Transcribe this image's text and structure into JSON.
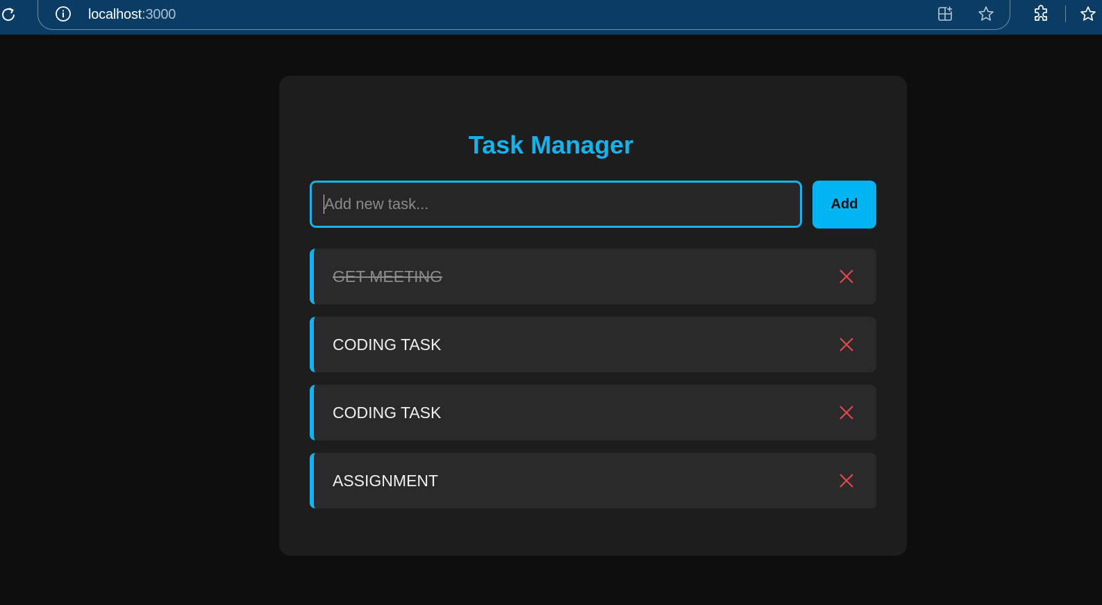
{
  "browser": {
    "url_host": "localhost",
    "url_port": ":3000",
    "icons": [
      "reload-icon",
      "info-icon",
      "app-available-icon",
      "favorite-star-icon",
      "extensions-icon",
      "favorites-icon"
    ]
  },
  "app": {
    "title": "Task Manager",
    "input": {
      "placeholder": "Add new task...",
      "value": ""
    },
    "add_label": "Add",
    "tasks": [
      {
        "text": "GET MEETING",
        "completed": true
      },
      {
        "text": "CODING TASK",
        "completed": false
      },
      {
        "text": "CODING TASK",
        "completed": false
      },
      {
        "text": "ASSIGNMENT",
        "completed": false
      }
    ],
    "colors": {
      "accent": "#14b3ef",
      "button": "#03b4f2",
      "delete": "#e5484d",
      "background": "#0e0e0e",
      "card": "#1d1d1d",
      "task": "#2a2a2a"
    }
  }
}
